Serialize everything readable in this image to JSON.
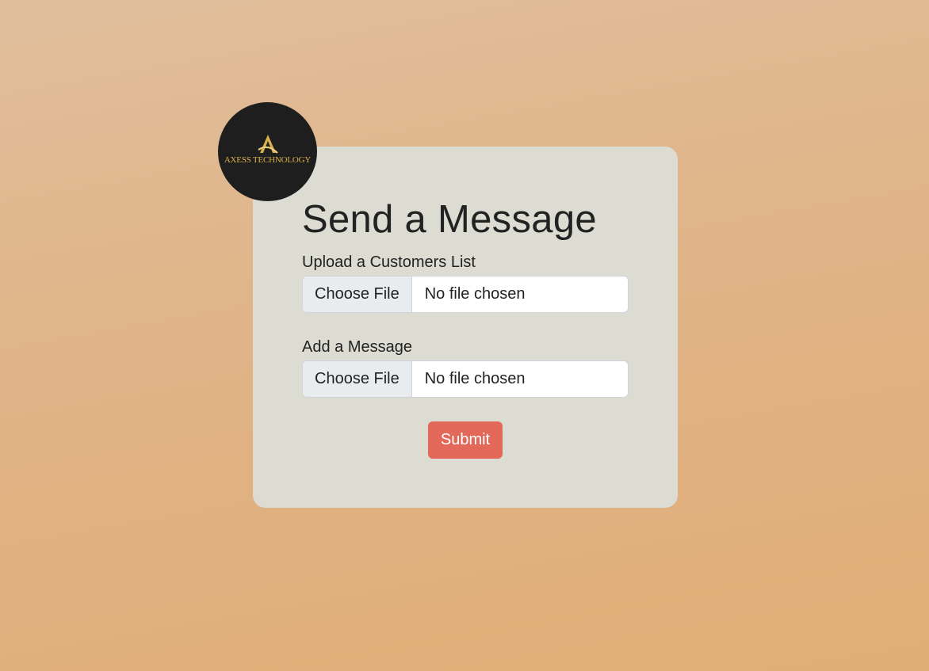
{
  "brand": {
    "logo_text": "AXESS TECHNOLOGY",
    "logo_bg": "#1e1e1e",
    "logo_accent": "#d8b04a"
  },
  "form": {
    "title": "Send a Message",
    "fields": [
      {
        "label": "Upload a Customers List",
        "button_label": "Choose File",
        "status": "No file chosen"
      },
      {
        "label": "Add a Message",
        "button_label": "Choose File",
        "status": "No file chosen"
      }
    ],
    "submit_label": "Submit",
    "submit_color": "#e2695a"
  }
}
